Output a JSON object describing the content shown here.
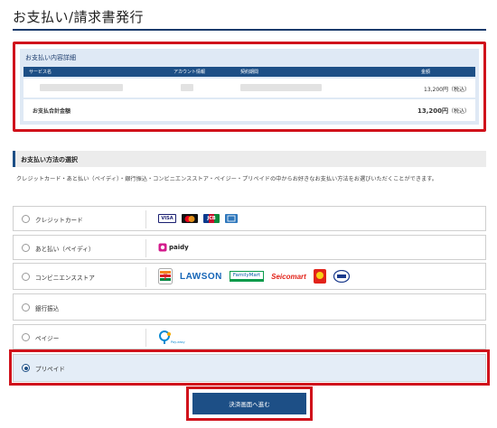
{
  "page": {
    "title": "お支払い/請求書発行"
  },
  "details": {
    "heading": "お支払い内容詳細",
    "columns": [
      "サービス名",
      "アカウント情報",
      "契約期間",
      "金額"
    ],
    "row_price": "13,200円（税込）",
    "total_label": "お支払合計金額",
    "total_amount": "13,200円",
    "total_tax": "（税込）"
  },
  "method": {
    "heading": "お支払い方法の選択",
    "description": "クレジットカード・あと払い（ペイディ）・銀行振込・コンビニエンスストア・ペイジー・プリペイドの中からお好きなお支払い方法をお選びいただくことができます。",
    "options": [
      {
        "label": "クレジットカード",
        "selected": false
      },
      {
        "label": "あと払い（ペイディ）",
        "selected": false
      },
      {
        "label": "コンビニエンスストア",
        "selected": false
      },
      {
        "label": "銀行振込",
        "selected": false
      },
      {
        "label": "ペイジー",
        "selected": false
      },
      {
        "label": "プリペイド",
        "selected": true
      }
    ],
    "logos": {
      "visa": "VISA",
      "jcb": "JCB",
      "paidy": "paidy",
      "lawson": "LAWSON",
      "familymart": "FamilyMart",
      "seicomart": "Seicomart",
      "payeasy": "Pay-easy"
    }
  },
  "submit": {
    "label": "決済画面へ進む"
  },
  "colors": {
    "navy": "#1d4f86",
    "highlight": "#d0121b",
    "panel": "#dfe9f5"
  }
}
